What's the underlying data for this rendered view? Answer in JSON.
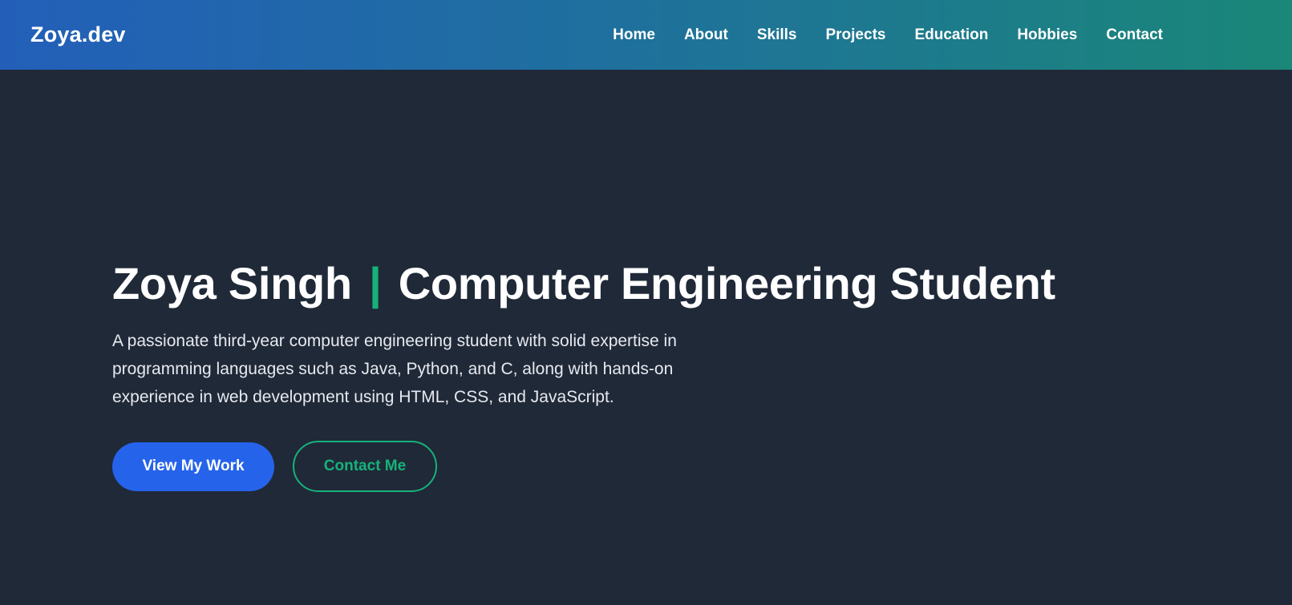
{
  "nav": {
    "brand": "Zoya.dev",
    "items": [
      {
        "label": "Home"
      },
      {
        "label": "About"
      },
      {
        "label": "Skills"
      },
      {
        "label": "Projects"
      },
      {
        "label": "Education"
      },
      {
        "label": "Hobbies"
      },
      {
        "label": "Contact"
      }
    ]
  },
  "hero": {
    "name": "Zoya Singh",
    "separator": "|",
    "role": "Computer Engineering Student",
    "description": "A passionate third-year computer engineering student with solid expertise in programming languages such as Java, Python, and C, along with hands-on experience in web development using HTML, CSS, and JavaScript.",
    "primary_button": "View My Work",
    "secondary_button": "Contact Me"
  },
  "colors": {
    "background": "#202938",
    "accent_green": "#16b27a",
    "primary_blue": "#2563eb",
    "nav_gradient_start": "#235fb9",
    "nav_gradient_end": "#1a8778"
  }
}
